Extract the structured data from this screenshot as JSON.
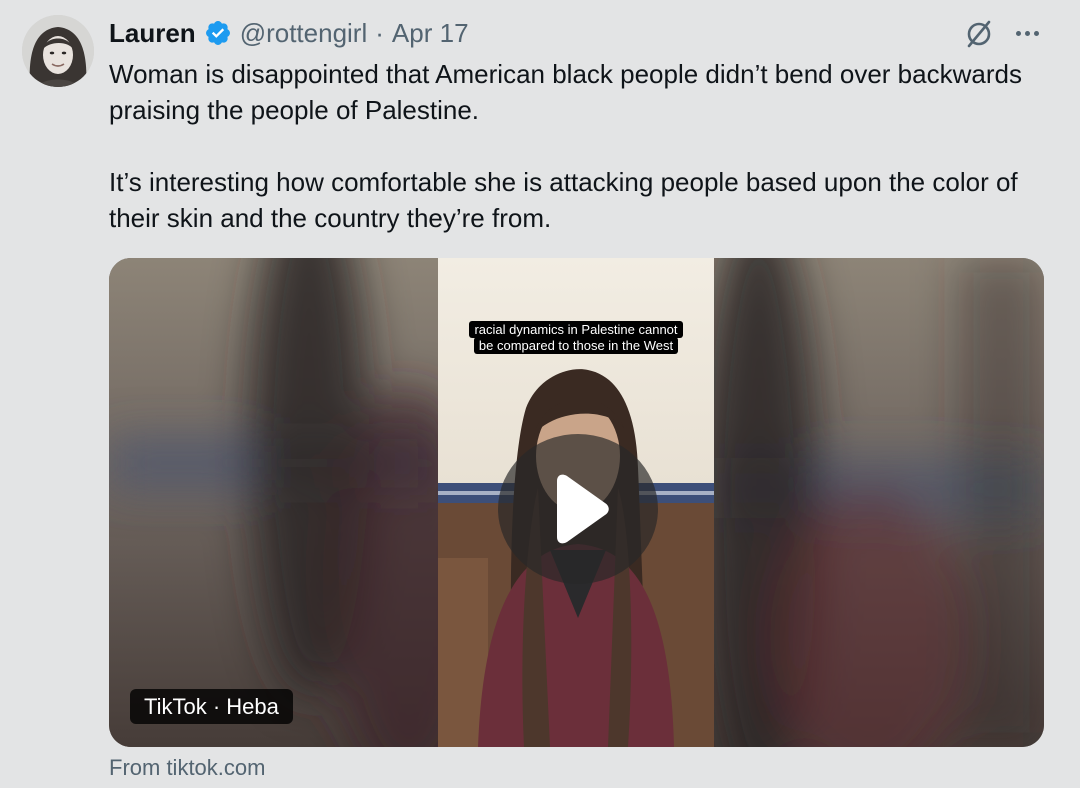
{
  "tweet": {
    "author_name": "Lauren",
    "handle": "@rottengirl",
    "separator": "·",
    "date": "Apr 17",
    "text_paragraphs": [
      "Woman is disappointed that American black people didn’t bend over backwards praising the people of Palestine.",
      "It’s interesting how comfortable she is attacking people based upon the color of their skin and the country they’re from."
    ]
  },
  "media": {
    "caption_lines": [
      "racial dynamics in Palestine cannot",
      "be compared to those in the West"
    ],
    "source_badge": "TikTok · Heba",
    "from_text": "From tiktok.com"
  },
  "icons": {
    "verified": "verified-badge-icon",
    "grok": "grok-icon",
    "more": "more-options-icon",
    "play": "play-icon"
  },
  "colors": {
    "background": "#e3e4e5",
    "text": "#0f1419",
    "secondary_text": "#536471",
    "verified_blue": "#1d9bf0"
  }
}
